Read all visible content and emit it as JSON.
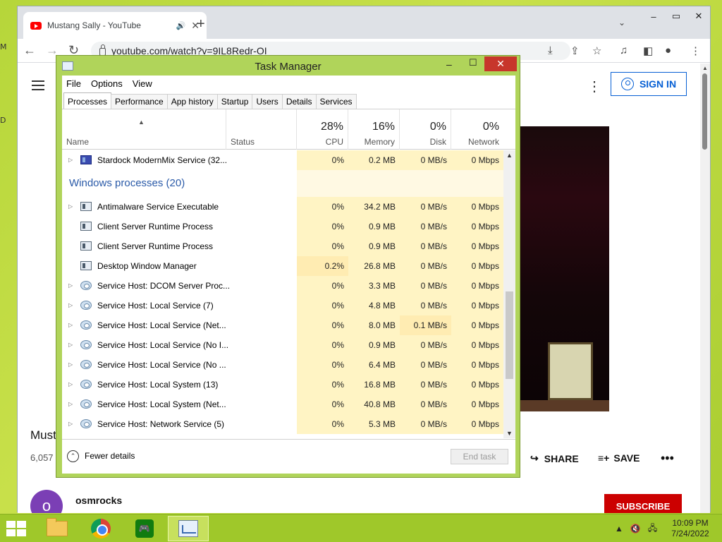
{
  "desktop": {
    "edge_glyphs": [
      "M",
      "D"
    ]
  },
  "browser": {
    "tab_title": "Mustang Sally - YouTube",
    "tab_audio_icon": "speaker-icon",
    "tab_close": "✕",
    "new_tab": "+",
    "url": "youtube.com/watch?v=9IL8Redr-OI",
    "nav": {
      "back": "←",
      "forward": "→",
      "reload": "↻"
    }
  },
  "youtube": {
    "sign_in": "SIGN IN",
    "video_title": "Must",
    "view_count": "6,057",
    "share": "SHARE",
    "save": "SAVE",
    "more": "•••",
    "channel_avatar": "o",
    "channel_name": "osmrocks",
    "subscribe": "SUBSCRIBE"
  },
  "task_manager": {
    "title": "Task Manager",
    "menu": [
      "File",
      "Options",
      "View"
    ],
    "tabs": [
      "Processes",
      "Performance",
      "App history",
      "Startup",
      "Users",
      "Details",
      "Services"
    ],
    "active_tab": "Processes",
    "columns": {
      "name": "Name",
      "status": "Status",
      "cpu": {
        "percent": "28%",
        "label": "CPU"
      },
      "memory": {
        "percent": "16%",
        "label": "Memory"
      },
      "disk": {
        "percent": "0%",
        "label": "Disk"
      },
      "network": {
        "percent": "0%",
        "label": "Network"
      }
    },
    "top_row": {
      "name": "Stardock ModernMix Service (32...",
      "cpu": "0%",
      "memory": "0.2 MB",
      "disk": "0 MB/s",
      "network": "0 Mbps",
      "icon": "app-icon",
      "expandable": true
    },
    "group_title": "Windows processes (20)",
    "rows": [
      {
        "name": "Antimalware Service Executable",
        "cpu": "0%",
        "memory": "34.2 MB",
        "disk": "0 MB/s",
        "network": "0 Mbps",
        "icon": "process-icon",
        "expandable": true
      },
      {
        "name": "Client Server Runtime Process",
        "cpu": "0%",
        "memory": "0.9 MB",
        "disk": "0 MB/s",
        "network": "0 Mbps",
        "icon": "process-icon",
        "expandable": false
      },
      {
        "name": "Client Server Runtime Process",
        "cpu": "0%",
        "memory": "0.9 MB",
        "disk": "0 MB/s",
        "network": "0 Mbps",
        "icon": "process-icon",
        "expandable": false
      },
      {
        "name": "Desktop Window Manager",
        "cpu": "0.2%",
        "memory": "26.8 MB",
        "disk": "0 MB/s",
        "network": "0 Mbps",
        "icon": "process-icon",
        "expandable": false
      },
      {
        "name": "Service Host: DCOM Server Proc...",
        "cpu": "0%",
        "memory": "3.3 MB",
        "disk": "0 MB/s",
        "network": "0 Mbps",
        "icon": "gear-icon",
        "expandable": true
      },
      {
        "name": "Service Host: Local Service (7)",
        "cpu": "0%",
        "memory": "4.8 MB",
        "disk": "0 MB/s",
        "network": "0 Mbps",
        "icon": "gear-icon",
        "expandable": true
      },
      {
        "name": "Service Host: Local Service (Net...",
        "cpu": "0%",
        "memory": "8.0 MB",
        "disk": "0.1 MB/s",
        "network": "0 Mbps",
        "icon": "gear-icon",
        "expandable": true
      },
      {
        "name": "Service Host: Local Service (No I...",
        "cpu": "0%",
        "memory": "0.9 MB",
        "disk": "0 MB/s",
        "network": "0 Mbps",
        "icon": "gear-icon",
        "expandable": true
      },
      {
        "name": "Service Host: Local Service (No ...",
        "cpu": "0%",
        "memory": "6.4 MB",
        "disk": "0 MB/s",
        "network": "0 Mbps",
        "icon": "gear-icon",
        "expandable": true
      },
      {
        "name": "Service Host: Local System (13)",
        "cpu": "0%",
        "memory": "16.8 MB",
        "disk": "0 MB/s",
        "network": "0 Mbps",
        "icon": "gear-icon",
        "expandable": true
      },
      {
        "name": "Service Host: Local System (Net...",
        "cpu": "0%",
        "memory": "40.8 MB",
        "disk": "0 MB/s",
        "network": "0 Mbps",
        "icon": "gear-icon",
        "expandable": true
      },
      {
        "name": "Service Host: Network Service (5)",
        "cpu": "0%",
        "memory": "5.3 MB",
        "disk": "0 MB/s",
        "network": "0 Mbps",
        "icon": "gear-icon",
        "expandable": true
      }
    ],
    "footer": {
      "fewer_details": "Fewer details",
      "end_task": "End task"
    }
  },
  "taskbar": {
    "clock_time": "10:09 PM",
    "clock_date": "7/24/2022"
  }
}
